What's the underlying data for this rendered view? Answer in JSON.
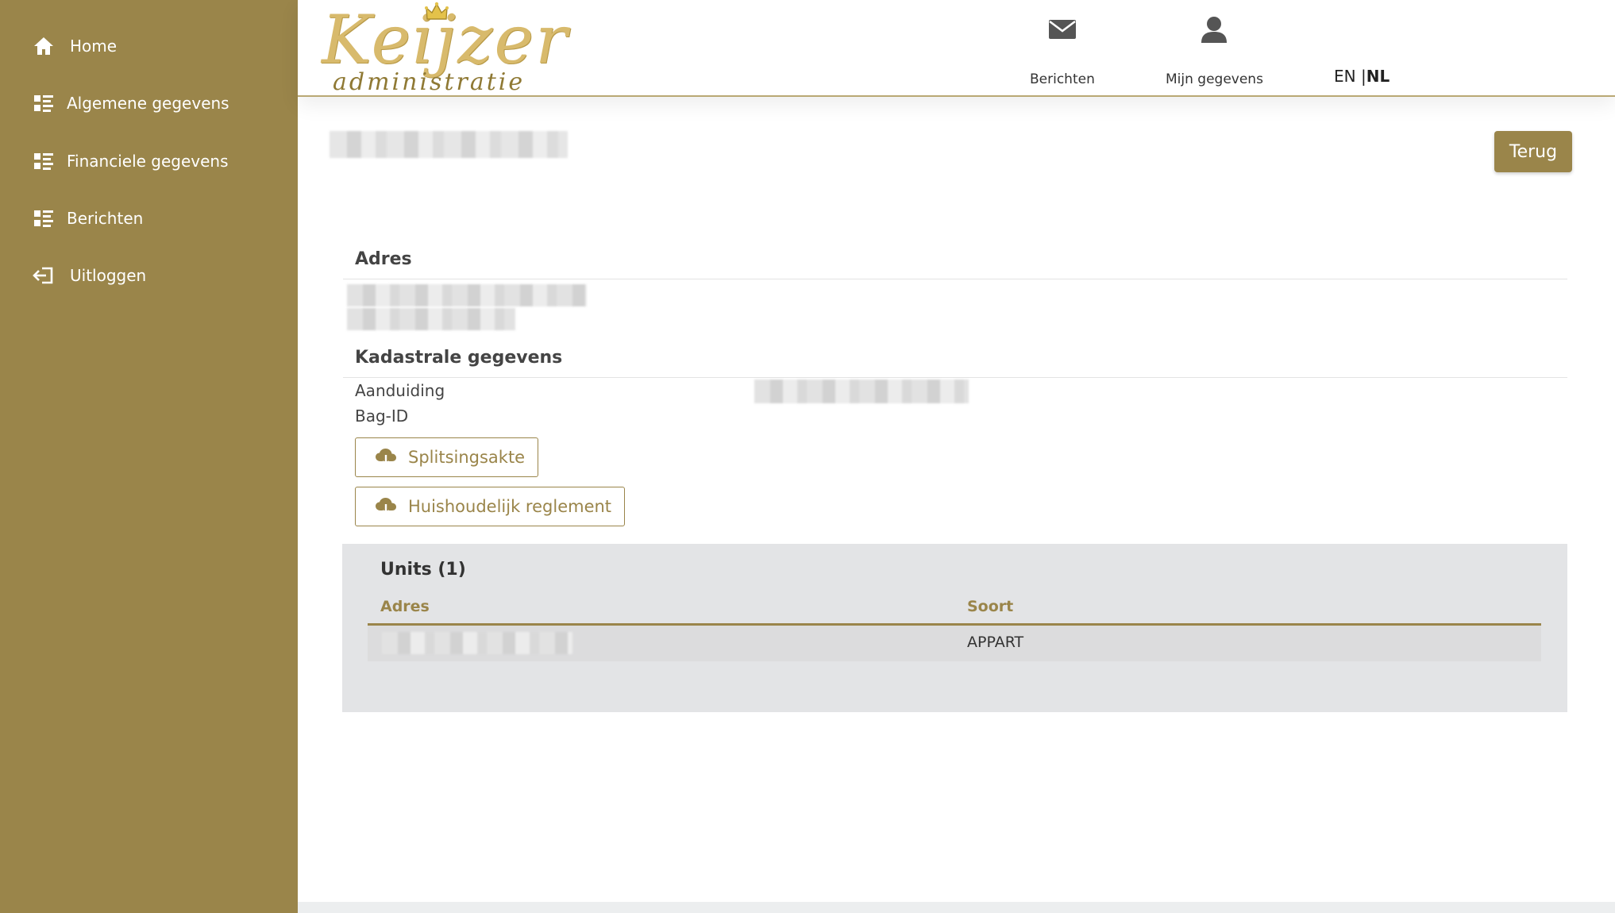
{
  "sidebar": {
    "items": [
      {
        "label": "Home",
        "icon": "home-icon"
      },
      {
        "label": "Algemene gegevens",
        "icon": "list-icon"
      },
      {
        "label": "Financiele gegevens",
        "icon": "list-icon"
      },
      {
        "label": "Berichten",
        "icon": "list-icon"
      },
      {
        "label": "Uitloggen",
        "icon": "logout-icon"
      }
    ]
  },
  "header": {
    "logo_text": "Keijzer",
    "logo_subtext": "administratie",
    "messages_label": "Berichten",
    "profile_label": "Mijn gegevens",
    "lang_en": "EN",
    "lang_separator": "|",
    "lang_nl": "NL"
  },
  "main": {
    "back_label": "Terug",
    "address_heading": "Adres",
    "cadastral_heading": "Kadastrale gegevens",
    "designation_label": "Aanduiding",
    "bag_id_label": "Bag-ID",
    "split_deed_label": "Splitsingsakte",
    "house_rules_label": "Huishoudelijk reglement"
  },
  "units": {
    "title": "Units (1)",
    "columns": [
      "Adres",
      "Soort"
    ],
    "rows": [
      {
        "type": "APPART"
      }
    ]
  },
  "colors": {
    "brand": "#9a854a",
    "logo_gold": "#d8ba6c",
    "panel_bg": "#e3e4e6"
  }
}
